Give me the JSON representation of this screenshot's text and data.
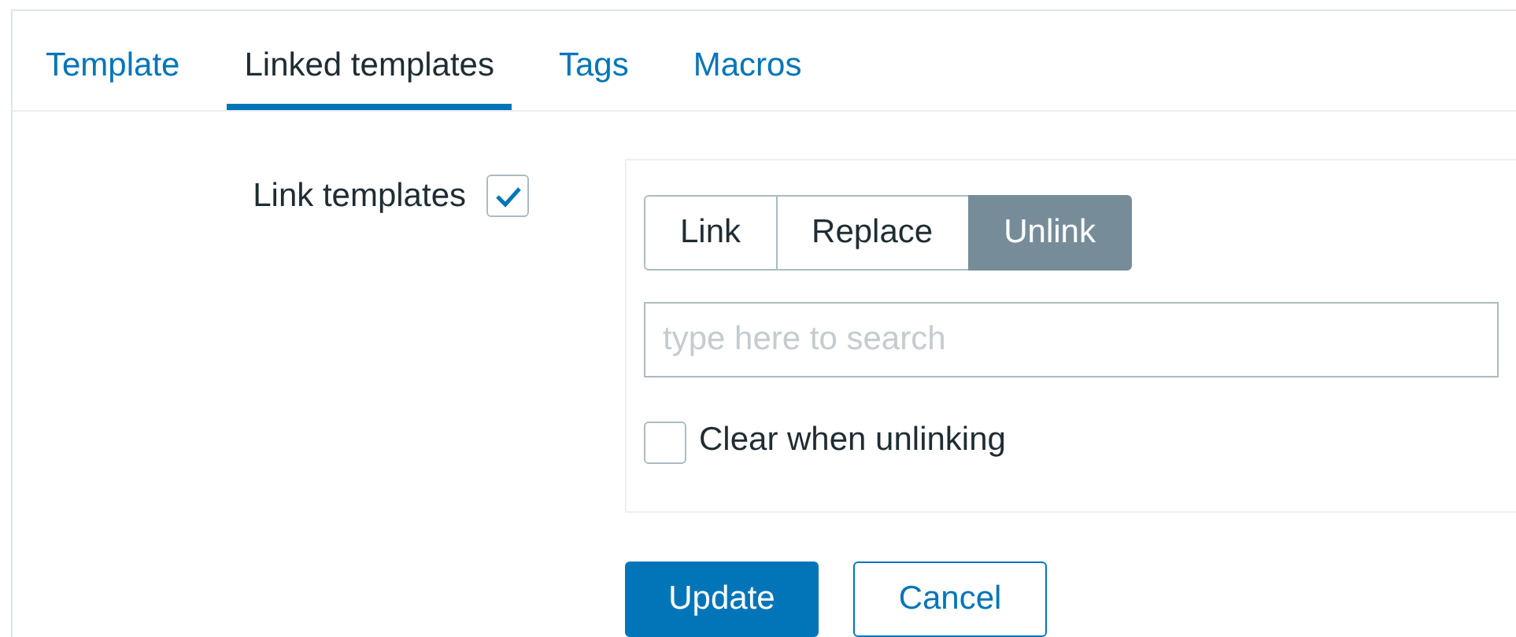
{
  "tabs": [
    {
      "label": "Template",
      "selected": false
    },
    {
      "label": "Linked templates",
      "selected": true
    },
    {
      "label": "Tags",
      "selected": false
    },
    {
      "label": "Macros",
      "selected": false
    }
  ],
  "link_templates": {
    "label": "Link templates",
    "checked": true
  },
  "mode_buttons": [
    {
      "label": "Link",
      "selected": false
    },
    {
      "label": "Replace",
      "selected": false
    },
    {
      "label": "Unlink",
      "selected": true
    }
  ],
  "search": {
    "placeholder": "type here to search"
  },
  "clear_when_unlinking": {
    "label": "Clear when unlinking",
    "checked": false
  },
  "buttons": [
    {
      "label": "Update",
      "kind": "primary"
    },
    {
      "label": "Cancel",
      "kind": "secondary"
    }
  ]
}
